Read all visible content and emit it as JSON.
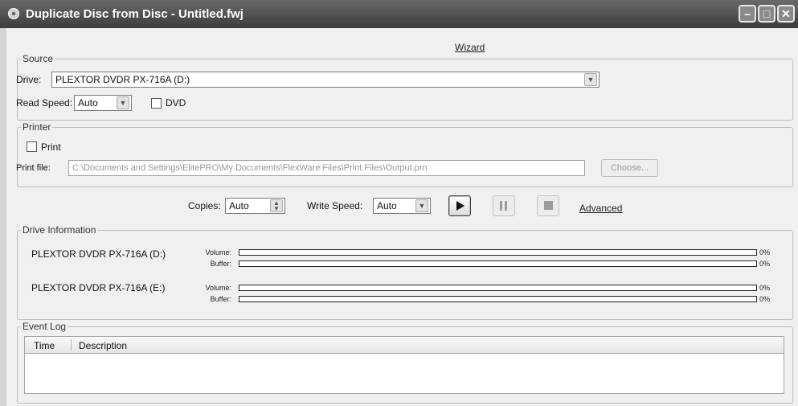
{
  "window": {
    "title": "Duplicate Disc from Disc - Untitled.fwj",
    "controls": {
      "minimize": "–",
      "maximize": "□",
      "close": "✕"
    }
  },
  "wizard_link": "Wizard",
  "source": {
    "legend": "Source",
    "drive_label": "Drive:",
    "drive_value": "PLEXTOR DVDR   PX-716A (D:)",
    "read_speed_label": "Read Speed:",
    "read_speed_value": "Auto",
    "dvd_label": "DVD",
    "dvd_checked": false
  },
  "printer": {
    "legend": "Printer",
    "print_label": "Print",
    "print_checked": false,
    "print_file_label": "Print file:",
    "print_file_value": "C:\\Documents and Settings\\ElitePRO\\My Documents\\FlexWare Files\\Print Files\\Output.prn",
    "choose_label": "Choose..."
  },
  "controls": {
    "copies_label": "Copies:",
    "copies_value": "Auto",
    "write_speed_label": "Write Speed:",
    "write_speed_value": "Auto",
    "advanced_link": "Advanced"
  },
  "drive_info": {
    "legend": "Drive Information",
    "drives": [
      {
        "name": "PLEXTOR DVDR   PX-716A (D:)",
        "volume_label": "Volume:",
        "buffer_label": "Buffer:",
        "volume_pct": "0%",
        "buffer_pct": "0%"
      },
      {
        "name": "PLEXTOR DVDR   PX-716A (E:)",
        "volume_label": "Volume:",
        "buffer_label": "Buffer:",
        "volume_pct": "0%",
        "buffer_pct": "0%"
      }
    ]
  },
  "event_log": {
    "legend": "Event Log",
    "columns": [
      "Time",
      "Description"
    ]
  }
}
